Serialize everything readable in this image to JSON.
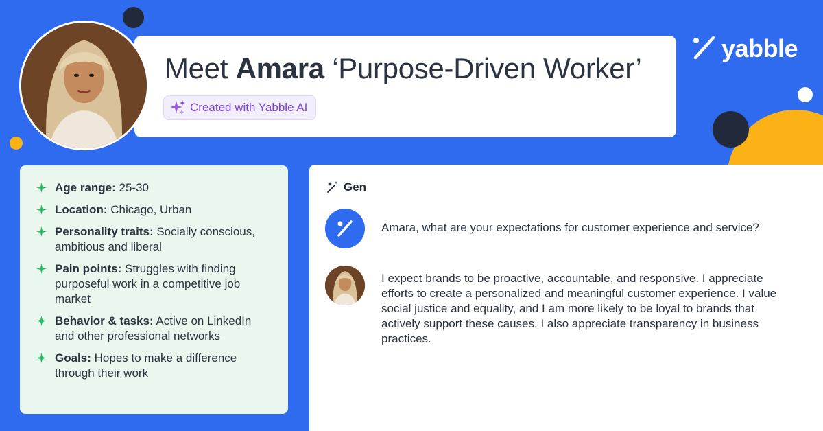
{
  "header": {
    "title_prefix": "Meet",
    "title_name": "Amara",
    "title_suffix": "‘Purpose-Driven Worker’",
    "badge_label": "Created with Yabble AI"
  },
  "brand": {
    "logo_text": "yabble",
    "logo_icon": "percent-slash-icon"
  },
  "attributes": [
    {
      "label": "Age range:",
      "value": "25-30"
    },
    {
      "label": "Location:",
      "value": "Chicago, Urban"
    },
    {
      "label": "Personality traits:",
      "value": "Socially conscious, ambitious and liberal"
    },
    {
      "label": "Pain points:",
      "value": "Struggles with finding purposeful work in a competitive job market"
    },
    {
      "label": "Behavior & tasks:",
      "value": "Active on LinkedIn and other professional networks"
    },
    {
      "label": "Goals:",
      "value": "Hopes to make a difference through their work"
    }
  ],
  "chat": {
    "section_label": "Gen",
    "question": "Amara, what are your expectations for customer experience and service?",
    "answer": "I expect brands to be proactive, accountable, and responsive. I appreciate efforts to create a personalized and meaningful customer experience. I value social justice and equality, and I am more likely to be loyal to brands that actively support these causes. I also appreciate transparency in business practices."
  },
  "colors": {
    "background": "#2f6bee",
    "accent_yellow": "#fbb216",
    "dark": "#22293a",
    "attr_card": "#eaf7ee",
    "star_green": "#1fbf5c",
    "badge_purple": "#7c43d8"
  }
}
